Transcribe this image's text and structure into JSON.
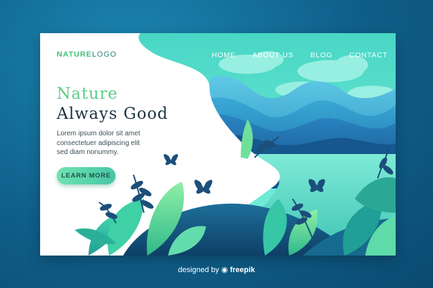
{
  "logo": {
    "part1": "NATURE",
    "part2": "LOGO"
  },
  "nav": {
    "items": [
      "HOME",
      "ABOUT US",
      "BLOG",
      "CONTACT"
    ]
  },
  "hero": {
    "title_line1": "Nature",
    "title_line2": "Always Good",
    "body_lines": [
      "Lorem ipsum dolor sit amet",
      "consectetuer adipiscing elit",
      "sed diam nonummy."
    ],
    "cta_label": "LEARN MORE"
  },
  "credit": {
    "prefix": "designed by",
    "brand": "freepik"
  },
  "colors": {
    "background": "#0f5f8a",
    "accent_green": "#5ecd86",
    "dark_text": "#1c3340",
    "sky": "#5fe0d6",
    "button": "#5ad6ac"
  },
  "icons": [
    "butterfly-icon",
    "fern-icon",
    "freepik-logo-icon"
  ]
}
